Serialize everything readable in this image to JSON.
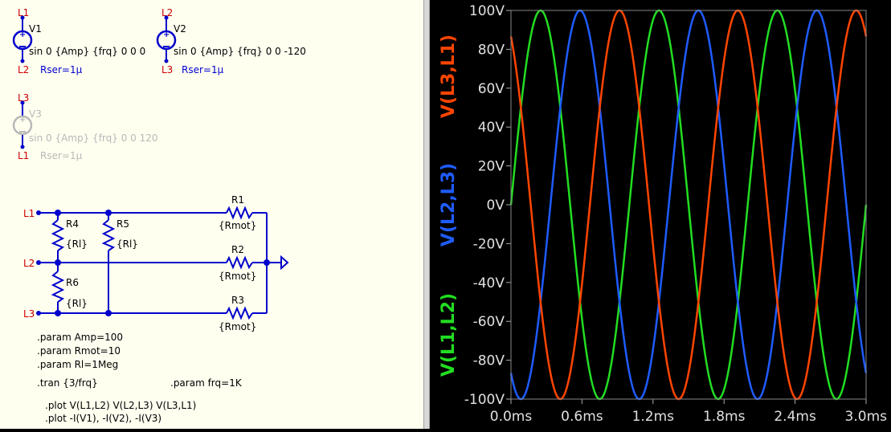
{
  "schematic": {
    "sources": [
      {
        "name": "V1",
        "top_node": "L1",
        "bottom_node": "L2",
        "spec": "sin 0 {Amp} {frq} 0 0 0",
        "rser": "Rser=1µ",
        "disabled": false
      },
      {
        "name": "V2",
        "top_node": "L2",
        "bottom_node": "L3",
        "spec": "sin 0 {Amp} {frq} 0 0 -120",
        "rser": "Rser=1µ",
        "disabled": false
      },
      {
        "name": "V3",
        "top_node": "L3",
        "bottom_node": "L1",
        "spec": "sin 0 {Amp} {frq} 0 0 120",
        "rser": "Rser=1µ",
        "disabled": true
      }
    ],
    "network_labels": {
      "l1": "L1",
      "l2": "L2",
      "l3": "L3"
    },
    "resistors": [
      {
        "ref": "R1",
        "value": "{Rmot}"
      },
      {
        "ref": "R2",
        "value": "{Rmot}"
      },
      {
        "ref": "R3",
        "value": "{Rmot}"
      },
      {
        "ref": "R4",
        "value": "{Rl}"
      },
      {
        "ref": "R5",
        "value": "{Rl}"
      },
      {
        "ref": "R6",
        "value": "{Rl}"
      }
    ],
    "directives": {
      "param_amp": ".param Amp=100",
      "param_rmot": ".param Rmot=10",
      "param_rl": ".param Rl=1Meg",
      "tran": ".tran {3/frq}",
      "param_frq": ".param frq=1K",
      "plot1": ".plot V(L1,L2) V(L2,L3) V(L3,L1)",
      "plot2": ".plot -I(V1), -I(V2), -I(V3)"
    },
    "colors": {
      "wire": "#0000cc",
      "node": "#cc0000",
      "text": "#000000",
      "disabled": "#b8b8b8",
      "rser": "#0000cc"
    }
  },
  "waveform": {
    "y_tick_labels": [
      "100V",
      "80V",
      "60V",
      "40V",
      "20V",
      "0V",
      "-20V",
      "-40V",
      "-60V",
      "-80V",
      "-100V"
    ],
    "x_tick_labels": [
      "0.0ms",
      "0.6ms",
      "1.2ms",
      "1.8ms",
      "2.4ms",
      "3.0ms"
    ],
    "trace_labels": [
      {
        "text": "V(L3,L1)",
        "color": "#ff4500"
      },
      {
        "text": "V(L2,L3)",
        "color": "#1f5cff"
      },
      {
        "text": "V(L1,L2)",
        "color": "#22dd22"
      }
    ]
  },
  "chart_data": {
    "type": "line",
    "x_unit": "ms",
    "y_unit": "V",
    "xlim": [
      0,
      3.0
    ],
    "ylim": [
      -100,
      100
    ],
    "grid": false,
    "legend": "left-vertical",
    "series": [
      {
        "name": "V(L1,L2)",
        "color": "#22dd22",
        "amplitude": 100,
        "frequency_khz": 1,
        "phase_deg": 0
      },
      {
        "name": "V(L2,L3)",
        "color": "#1f5cff",
        "amplitude": 100,
        "frequency_khz": 1,
        "phase_deg": -120
      },
      {
        "name": "V(L3,L1)",
        "color": "#ff4500",
        "amplitude": 100,
        "frequency_khz": 1,
        "phase_deg": 120
      }
    ]
  }
}
